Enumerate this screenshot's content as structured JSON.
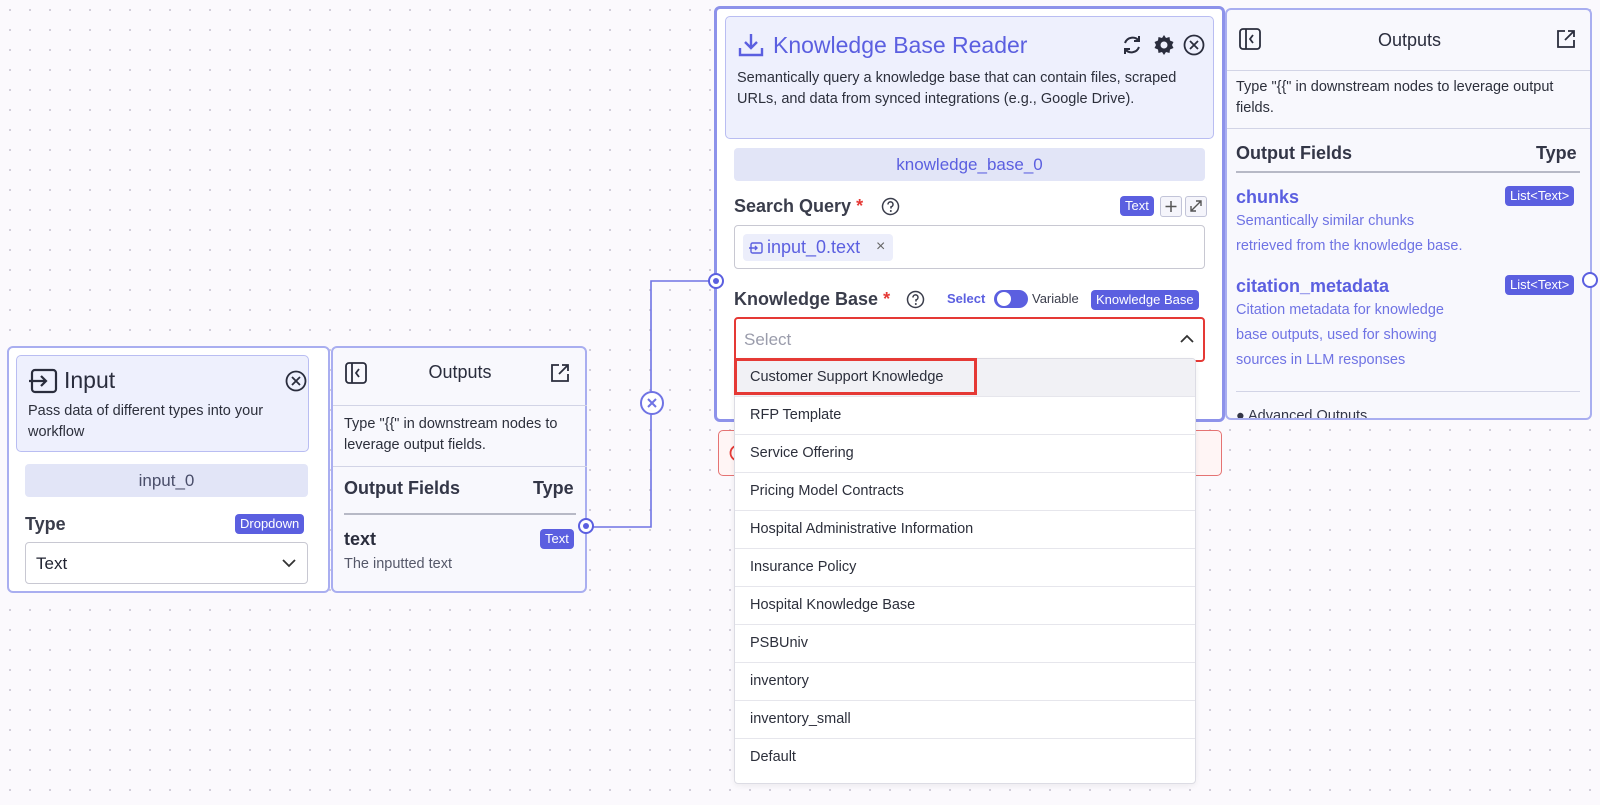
{
  "input_node": {
    "title": "Input",
    "description": "Pass data of different types into your workflow",
    "name": "input_0",
    "type_label": "Type",
    "type_badge": "Dropdown",
    "type_value": "Text"
  },
  "input_outputs": {
    "title": "Outputs",
    "hint": "Type \"{{\" in downstream nodes to leverage output fields.",
    "fields_header": "Output Fields",
    "type_header": "Type",
    "fields": [
      {
        "name": "text",
        "type": "Text",
        "description": "The inputted text"
      }
    ]
  },
  "kb_node": {
    "title": "Knowledge Base Reader",
    "description": "Semantically query a knowledge base that can contain files, scraped URLs, and data from synced integrations (e.g., Google Drive).",
    "name": "knowledge_base_0",
    "search_query": {
      "label": "Search Query",
      "required": "*",
      "badge": "Text",
      "token": "input_0.text",
      "token_close": "×"
    },
    "knowledge_base": {
      "label": "Knowledge Base",
      "required": "*",
      "toggle_left": "Select",
      "toggle_right": "Variable",
      "badge": "Knowledge Base",
      "placeholder": "Select"
    },
    "dropdown_options": [
      "Customer Support Knowledge",
      "RFP Template",
      "Service Offering",
      "Pricing Model Contracts",
      "Hospital Administrative Information",
      "Insurance Policy",
      "Hospital Knowledge Base",
      "PSBUniv",
      "inventory",
      "inventory_small",
      "Default"
    ]
  },
  "kb_outputs": {
    "title": "Outputs",
    "hint": "Type \"{{\" in downstream nodes to leverage output fields.",
    "fields_header": "Output Fields",
    "type_header": "Type",
    "fields": [
      {
        "name": "chunks",
        "type": "List<Text>",
        "description_lines": [
          "Semantically similar chunks",
          "retrieved from the knowledge base."
        ]
      },
      {
        "name": "citation_metadata",
        "type": "List<Text>",
        "description_lines": [
          "Citation metadata for knowledge",
          "base outputs, used for showing",
          "sources in LLM responses"
        ]
      }
    ],
    "advanced": "Advanced Outputs"
  },
  "colors": {
    "accent": "#5b5fe0",
    "highlight": "#e53935",
    "node_border": "#a9aef0"
  }
}
